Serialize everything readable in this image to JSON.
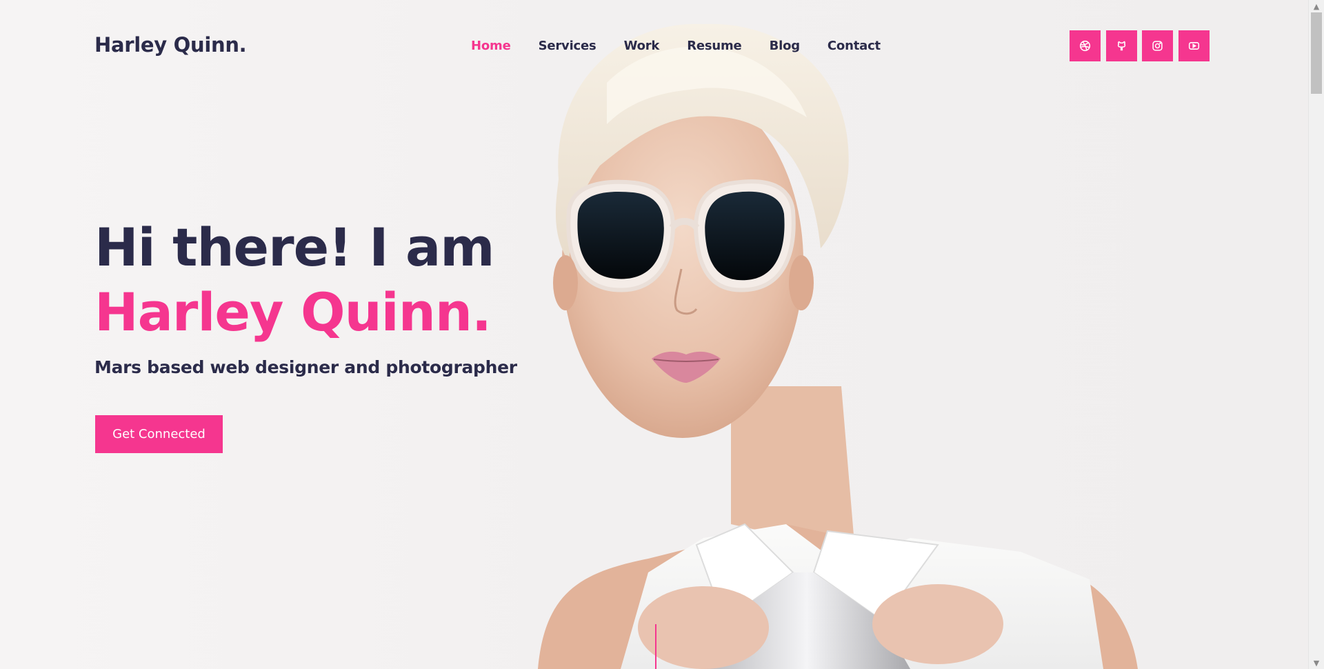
{
  "header": {
    "logo": "Harley Quinn.",
    "nav": [
      {
        "label": "Home",
        "active": true
      },
      {
        "label": "Services",
        "active": false
      },
      {
        "label": "Work",
        "active": false
      },
      {
        "label": "Resume",
        "active": false
      },
      {
        "label": "Blog",
        "active": false
      },
      {
        "label": "Contact",
        "active": false
      }
    ],
    "socials": [
      {
        "icon": "dribbble-icon"
      },
      {
        "icon": "github-icon"
      },
      {
        "icon": "instagram-icon"
      },
      {
        "icon": "youtube-icon"
      }
    ]
  },
  "hero": {
    "title_prefix": "Hi there! I am ",
    "title_name": "Harley Quinn.",
    "subtitle": "Mars based web designer and photographer",
    "cta_label": "Get Connected"
  },
  "colors": {
    "accent": "#f5368f",
    "text_dark": "#2b2b4a",
    "background": "#f3f1f1"
  },
  "scrollbar": {
    "up_arrow": "▲",
    "down_arrow": "▼"
  }
}
